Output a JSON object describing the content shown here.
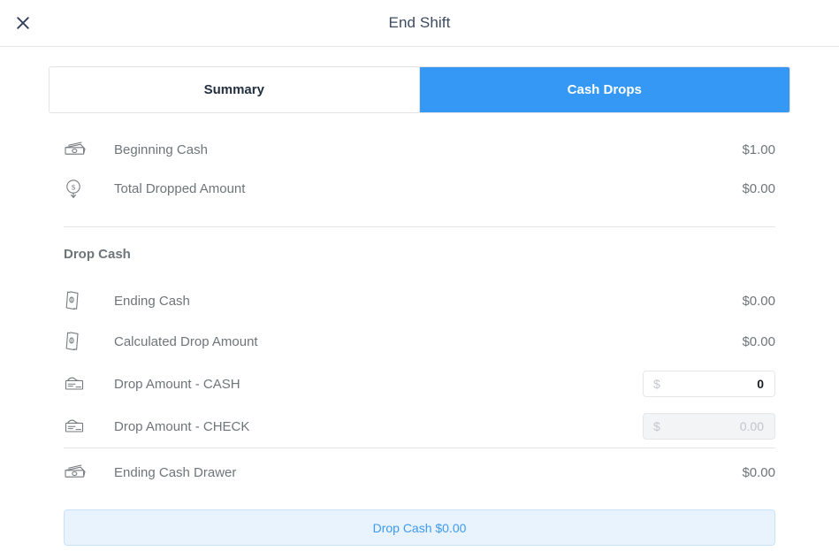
{
  "header": {
    "title": "End Shift",
    "close_icon": "close-icon"
  },
  "tabs": [
    {
      "label": "Summary",
      "active": false
    },
    {
      "label": "Cash Drops",
      "active": true
    }
  ],
  "summary_rows": [
    {
      "icon": "banknote-icon",
      "label": "Beginning Cash",
      "value": "$1.00"
    },
    {
      "icon": "money-drop-icon",
      "label": "Total Dropped Amount",
      "value": "$0.00"
    }
  ],
  "section": {
    "title": "Drop Cash"
  },
  "drop_rows": [
    {
      "icon": "cash-stack-icon",
      "label": "Ending Cash",
      "value": "$0.00"
    },
    {
      "icon": "cash-stack-icon",
      "label": "Calculated Drop Amount",
      "value": "$0.00"
    }
  ],
  "input_rows": [
    {
      "icon": "check-icon",
      "label": "Drop Amount - CASH",
      "currency": "$",
      "value": "0",
      "placeholder": "",
      "disabled": false
    },
    {
      "icon": "check-icon",
      "label": "Drop Amount - CHECK",
      "currency": "$",
      "value": "",
      "placeholder": "0.00",
      "disabled": true
    }
  ],
  "total_row": {
    "icon": "banknote-icon",
    "label": "Ending Cash Drawer",
    "value": "$0.00"
  },
  "footer": {
    "drop_cash_label": "Drop Cash $0.00"
  },
  "colors": {
    "accent_blue": "#3498f4",
    "button_bg": "#e9f3fd",
    "button_border": "#c9e2fb",
    "button_text": "#3d9af3",
    "title_text": "#3b4a61",
    "row_text": "#6e7579",
    "divider": "#e2e4e7"
  }
}
